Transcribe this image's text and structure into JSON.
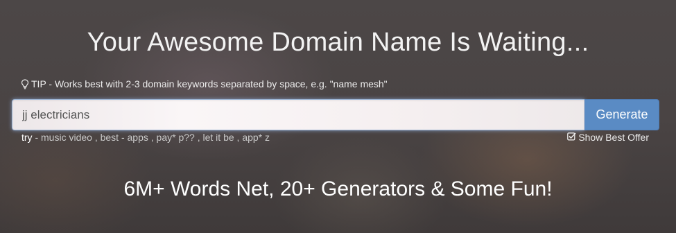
{
  "header": {
    "headline": "Your Awesome Domain Name Is Waiting..."
  },
  "tip": {
    "icon": "lightbulb-icon",
    "text": "TIP - Works best with 2-3 domain keywords separated by space, e.g. \"name mesh\""
  },
  "search": {
    "value": "jj electricians",
    "button_label": "Generate"
  },
  "suggestions": {
    "lead": "try",
    "dash": " - ",
    "items": [
      "music video",
      "best - apps",
      "pay* p??",
      "let it be",
      "app* z"
    ]
  },
  "options": {
    "show_best_offer_label": "Show Best Offer",
    "show_best_offer_checked": true
  },
  "tagline": "6M+ Words Net, 20+ Generators & Some Fun!",
  "colors": {
    "accent": "#5a8bc4",
    "background": "#4a4646"
  }
}
